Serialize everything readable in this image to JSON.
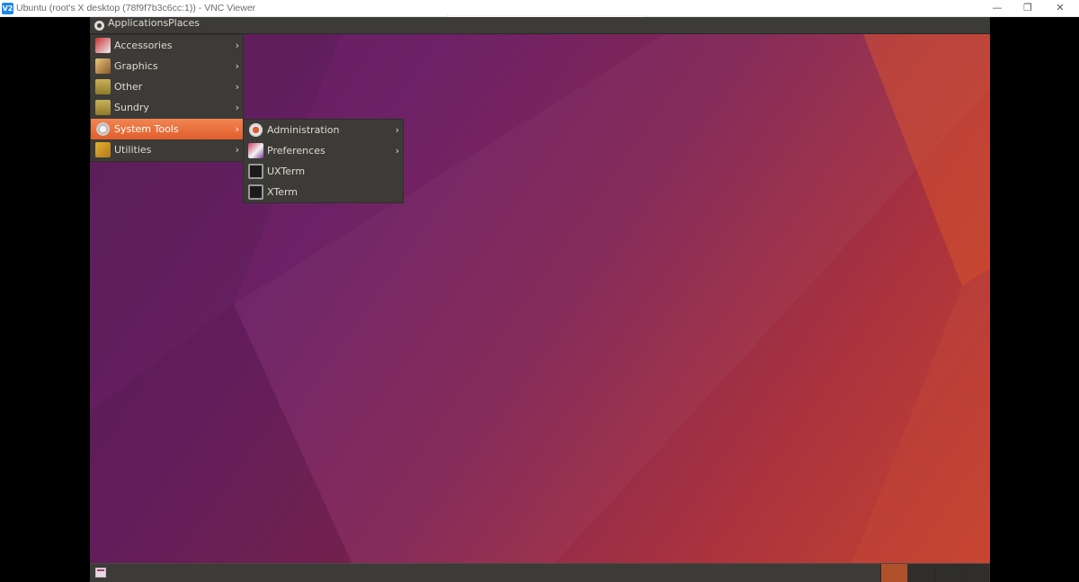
{
  "window": {
    "app_badge": "V2",
    "title": "Ubuntu (root's X desktop (78f9f7b3c6cc:1)) - VNC Viewer",
    "controls": {
      "minimize": "—",
      "maximize": "❐",
      "close": "✕"
    }
  },
  "top_panel": {
    "applications_label": "Applications",
    "places_label": "Places"
  },
  "main_menu": {
    "items": [
      {
        "label": "Accessories",
        "icon": "accessories-icon",
        "arrow": "›"
      },
      {
        "label": "Graphics",
        "icon": "graphics-icon",
        "arrow": "›"
      },
      {
        "label": "Other",
        "icon": "other-icon",
        "arrow": "›"
      },
      {
        "label": "Sundry",
        "icon": "sundry-icon",
        "arrow": "›"
      },
      {
        "label": "System Tools",
        "icon": "system-tools-icon",
        "arrow": "›",
        "active": true
      },
      {
        "label": "Utilities",
        "icon": "utilities-icon",
        "arrow": "›"
      }
    ]
  },
  "submenu": {
    "items": [
      {
        "label": "Administration",
        "icon": "administration-icon",
        "arrow": "›"
      },
      {
        "label": "Preferences",
        "icon": "preferences-icon",
        "arrow": "›"
      },
      {
        "label": "UXTerm",
        "icon": "terminal-icon"
      },
      {
        "label": "XTerm",
        "icon": "terminal-icon"
      }
    ]
  },
  "bottom_panel": {
    "workspaces": 4,
    "active_workspace": 1
  },
  "colors": {
    "panel": "#3c3b37",
    "menu_highlight": "#e9703e",
    "menu_text": "#dfdbd2",
    "active_workspace": "#b1512c"
  }
}
